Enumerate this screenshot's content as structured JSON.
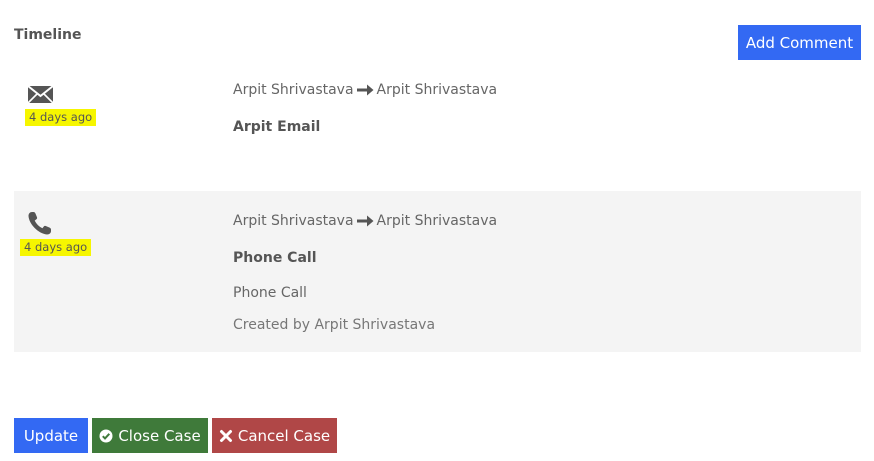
{
  "timeline": {
    "heading": "Timeline",
    "add_comment_label": "Add Comment",
    "entries": [
      {
        "icon": "envelope-icon",
        "time_ago": "4 days ago",
        "from": "Arpit Shrivastava",
        "to": "Arpit Shrivastava",
        "subject": "Arpit Email"
      },
      {
        "icon": "phone-icon",
        "time_ago": "4 days ago",
        "from": "Arpit Shrivastava",
        "to": "Arpit Shrivastava",
        "subject": "Phone Call",
        "description": "Phone Call",
        "created_by": "Created by Arpit Shrivastava"
      }
    ]
  },
  "actions": {
    "update_label": "Update",
    "close_case_label": "Close Case",
    "cancel_case_label": "Cancel Case"
  },
  "colors": {
    "primary": "#3369f3",
    "success": "#3f7a3a",
    "danger": "#b04747",
    "highlight": "#f6f600",
    "row_alt_bg": "#f4f4f4"
  }
}
